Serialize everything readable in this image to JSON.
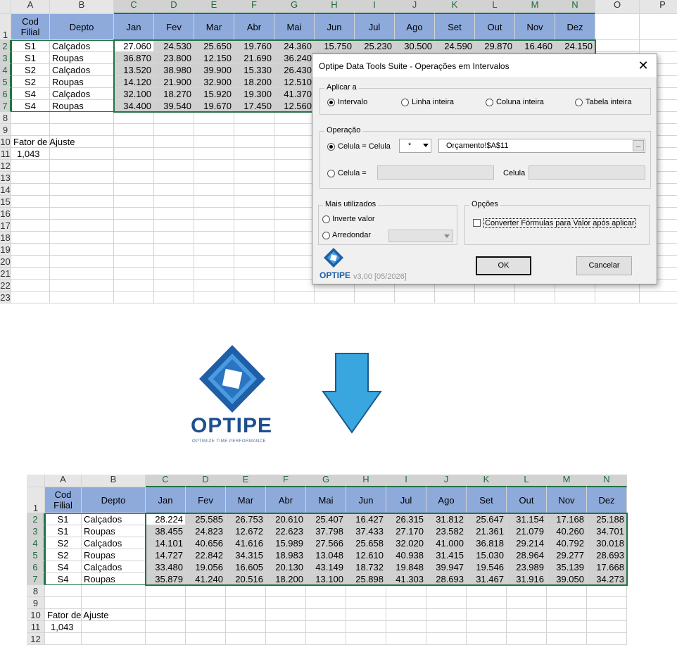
{
  "columns": [
    "A",
    "B",
    "C",
    "D",
    "E",
    "F",
    "G",
    "H",
    "I",
    "J",
    "K",
    "L",
    "M",
    "N",
    "O",
    "P"
  ],
  "header_row": {
    "cod_filial": "Cod\nFilial",
    "depto": "Depto",
    "months": [
      "Jan",
      "Fev",
      "Mar",
      "Abr",
      "Mai",
      "Jun",
      "Jul",
      "Ago",
      "Set",
      "Out",
      "Nov",
      "Dez"
    ]
  },
  "top_table": {
    "rows": [
      {
        "cod": "S1",
        "depto": "Calçados",
        "values": [
          "27.060",
          "24.530",
          "25.650",
          "19.760",
          "24.360",
          "15.750",
          "25.230",
          "30.500",
          "24.590",
          "29.870",
          "16.460",
          "24.150"
        ]
      },
      {
        "cod": "S1",
        "depto": "Roupas",
        "values": [
          "36.870",
          "23.800",
          "12.150",
          "21.690",
          "36.240",
          "",
          "",
          "",
          "",
          "",
          "",
          ""
        ]
      },
      {
        "cod": "S2",
        "depto": "Calçados",
        "values": [
          "13.520",
          "38.980",
          "39.900",
          "15.330",
          "26.430",
          "",
          "",
          "",
          "",
          "",
          "",
          ""
        ]
      },
      {
        "cod": "S2",
        "depto": "Roupas",
        "values": [
          "14.120",
          "21.900",
          "32.900",
          "18.200",
          "12.510",
          "",
          "",
          "",
          "",
          "",
          "",
          ""
        ]
      },
      {
        "cod": "S4",
        "depto": "Calçados",
        "values": [
          "32.100",
          "18.270",
          "15.920",
          "19.300",
          "41.370",
          "",
          "",
          "",
          "",
          "",
          "",
          ""
        ]
      },
      {
        "cod": "S4",
        "depto": "Roupas",
        "values": [
          "34.400",
          "39.540",
          "19.670",
          "17.450",
          "12.560",
          "",
          "",
          "",
          "",
          "",
          "",
          ""
        ]
      }
    ],
    "row_numbers": [
      "1",
      "2",
      "3",
      "4",
      "5",
      "6",
      "7",
      "8",
      "9",
      "10",
      "11",
      "12",
      "13",
      "14",
      "15",
      "16",
      "17",
      "18",
      "19",
      "20",
      "21",
      "22",
      "23"
    ]
  },
  "adjust": {
    "label": "Fator de Ajuste",
    "value": "1,043"
  },
  "dialog": {
    "title": "Optipe Data Tools Suite - Operações em Intervalos",
    "close": "✕",
    "apply_group": "Aplicar a",
    "apply_options": [
      "Intervalo",
      "Linha inteira",
      "Coluna inteira",
      "Tabela inteira"
    ],
    "op_group": "Operação",
    "op_cell_label": "Celula = Celula",
    "operator": "*",
    "ref_value": "Orçamento!$A$11",
    "ref_button": "_",
    "op_cell2_label": "Celula =",
    "celula_label": "Celula",
    "more_group": "Mais utilizados",
    "invert_label": "Inverte valor",
    "round_label": "Arredondar",
    "options_group": "Opções",
    "convert_label": "Converter Fórmulas para Valor após aplicar",
    "ok": "OK",
    "cancel": "Cancelar",
    "brand": "OPTIPE",
    "version": "v3,00 [05/2026]"
  },
  "logo": {
    "brand": "OPTIPE",
    "tagline": "OPTIMIZE TIME PERFORMANCE"
  },
  "bottom_table": {
    "columns": [
      "A",
      "B",
      "C",
      "D",
      "E",
      "F",
      "G",
      "H",
      "I",
      "J",
      "K",
      "L",
      "M",
      "N"
    ],
    "rows": [
      {
        "cod": "S1",
        "depto": "Calçados",
        "values": [
          "28.224",
          "25.585",
          "26.753",
          "20.610",
          "25.407",
          "16.427",
          "26.315",
          "31.812",
          "25.647",
          "31.154",
          "17.168",
          "25.188"
        ]
      },
      {
        "cod": "S1",
        "depto": "Roupas",
        "values": [
          "38.455",
          "24.823",
          "12.672",
          "22.623",
          "37.798",
          "37.433",
          "27.170",
          "23.582",
          "21.361",
          "21.079",
          "40.260",
          "34.701"
        ]
      },
      {
        "cod": "S2",
        "depto": "Calçados",
        "values": [
          "14.101",
          "40.656",
          "41.616",
          "15.989",
          "27.566",
          "25.658",
          "32.020",
          "41.000",
          "36.818",
          "29.214",
          "40.792",
          "30.018"
        ]
      },
      {
        "cod": "S2",
        "depto": "Roupas",
        "values": [
          "14.727",
          "22.842",
          "34.315",
          "18.983",
          "13.048",
          "12.610",
          "40.938",
          "31.415",
          "15.030",
          "28.964",
          "29.277",
          "28.693"
        ]
      },
      {
        "cod": "S4",
        "depto": "Calçados",
        "values": [
          "33.480",
          "19.056",
          "16.605",
          "20.130",
          "43.149",
          "18.732",
          "19.848",
          "39.947",
          "19.546",
          "23.989",
          "35.139",
          "17.668"
        ]
      },
      {
        "cod": "S4",
        "depto": "Roupas",
        "values": [
          "35.879",
          "41.240",
          "20.516",
          "18.200",
          "13.100",
          "25.898",
          "41.303",
          "28.693",
          "31.467",
          "31.916",
          "39.050",
          "34.273"
        ]
      }
    ],
    "row_numbers": [
      "1",
      "2",
      "3",
      "4",
      "5",
      "6",
      "7",
      "8",
      "9",
      "10",
      "11",
      "12"
    ]
  },
  "colors": {
    "header_blue": "#8eaadb",
    "data_gray": "#d0d0d0",
    "excel_green": "#217346",
    "arrow_blue": "#3aa6e0",
    "logo_blue": "#1e5fa8"
  }
}
